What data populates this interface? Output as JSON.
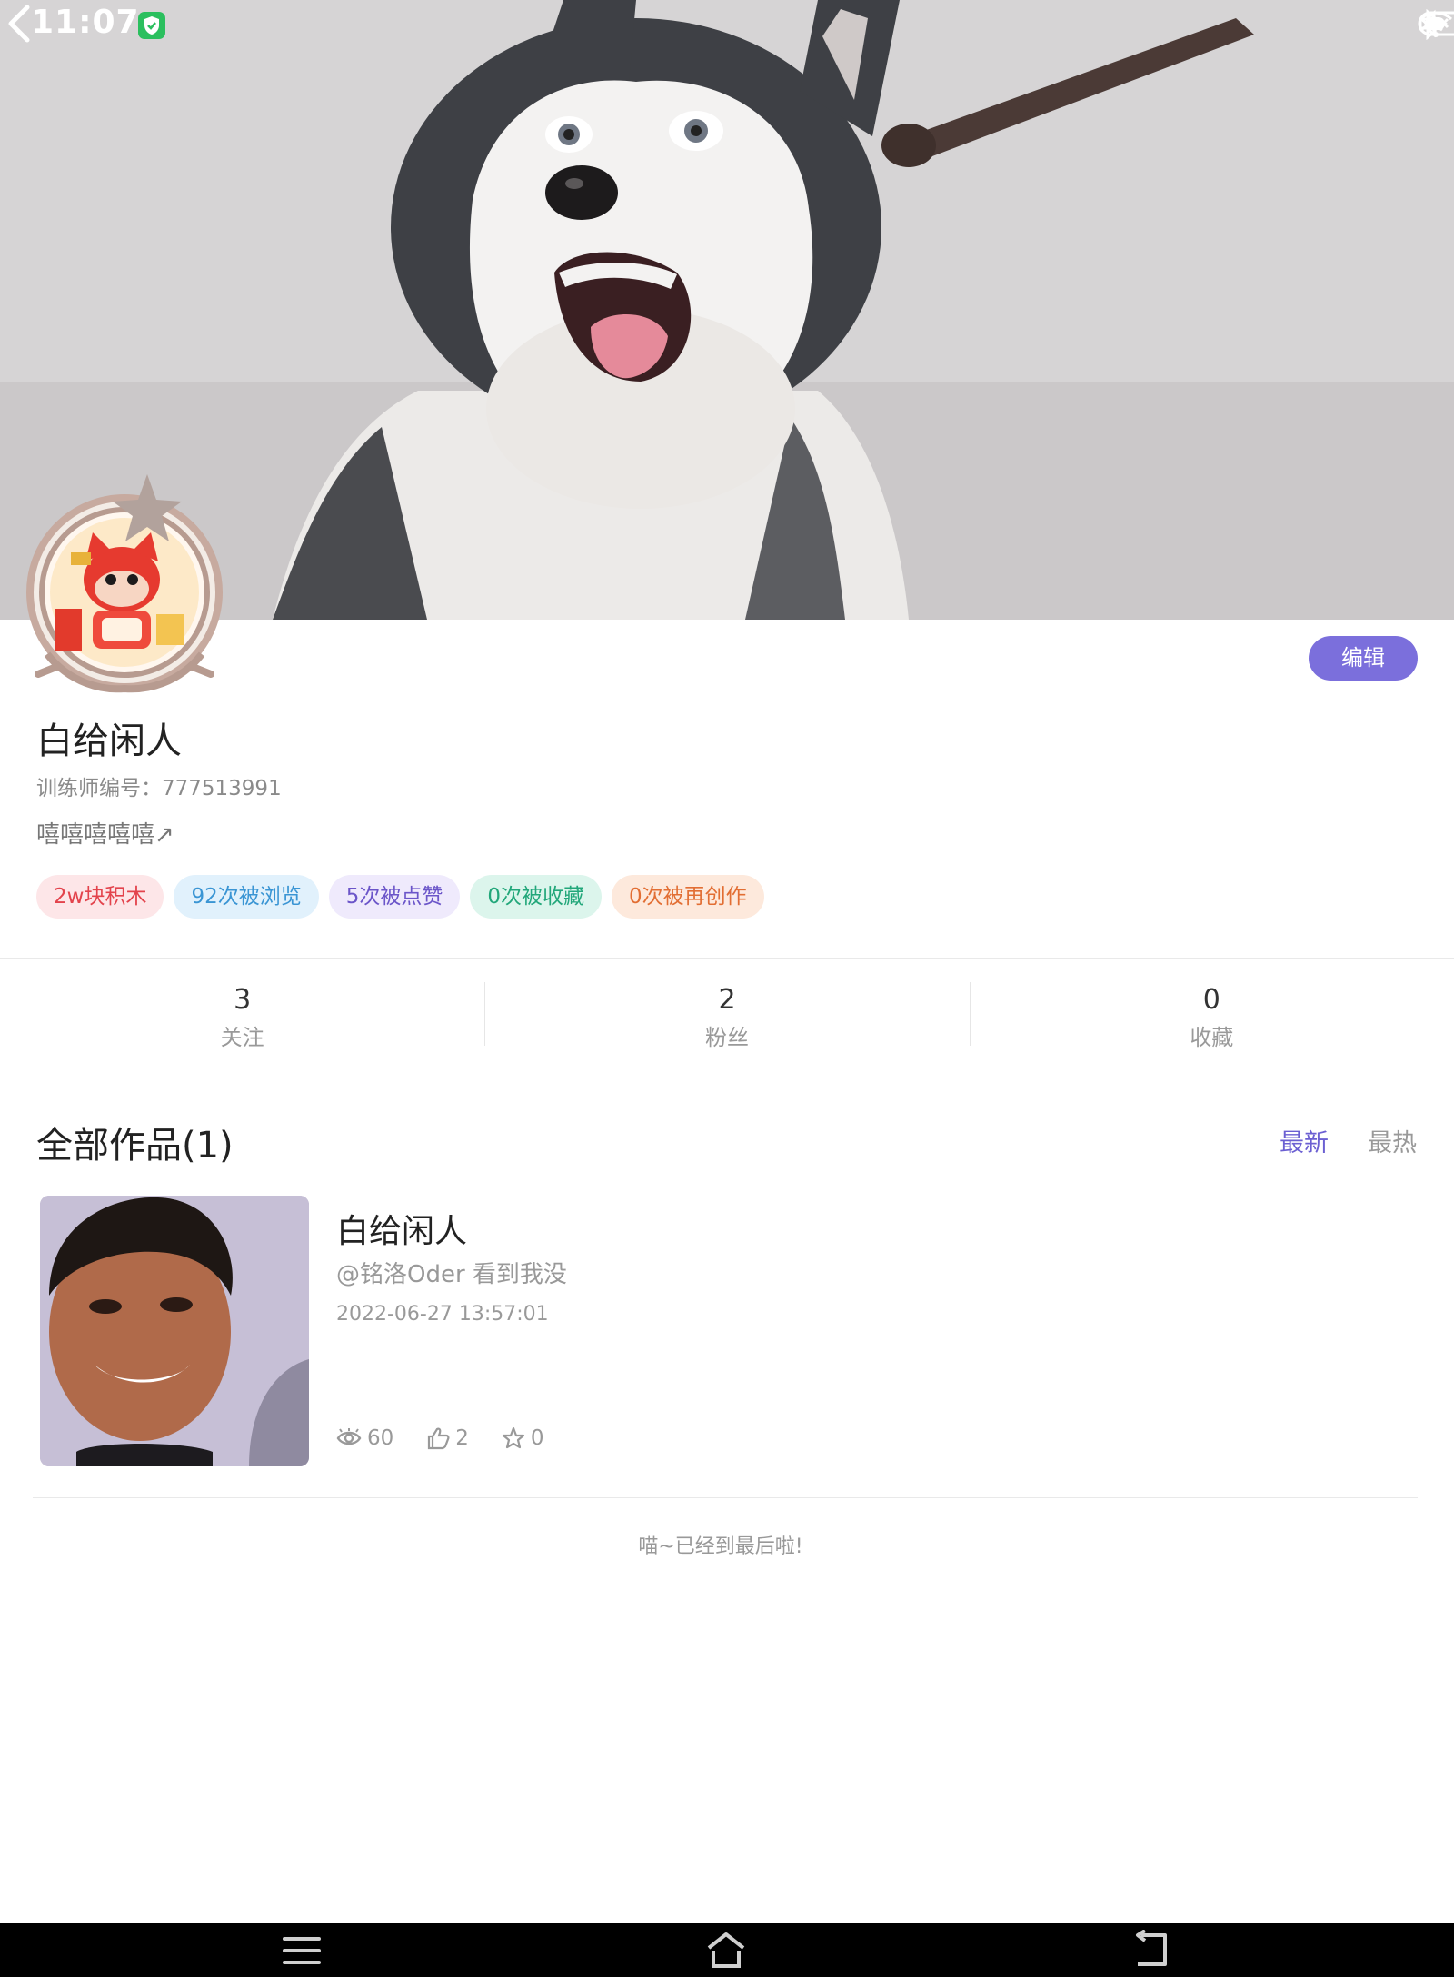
{
  "status_bar": {
    "time": "11:07"
  },
  "profile": {
    "edit_label": "编辑",
    "nickname": "白给闲人",
    "trainer_id_line": "训练师编号：777513991",
    "bio": "嘻嘻嘻嘻嘻↗",
    "tags": [
      "2w块积木",
      "92次被浏览",
      "5次被点赞",
      "0次被收藏",
      "0次被再创作"
    ]
  },
  "stats": [
    {
      "value": "3",
      "label": "关注"
    },
    {
      "value": "2",
      "label": "粉丝"
    },
    {
      "value": "0",
      "label": "收藏"
    }
  ],
  "works": {
    "title": "全部作品(1)",
    "sort_latest": "最新",
    "sort_hot": "最热",
    "items": [
      {
        "title": "白给闲人",
        "description": "@铭洛Oder 看到我没",
        "date": "2022-06-27 13:57:01",
        "views": "60",
        "likes": "2",
        "favorites": "0"
      }
    ],
    "end_note": "喵~已经到最后啦!"
  },
  "colors": {
    "accent": "#7b6fdc",
    "nav_bar": "#000000"
  },
  "icons": {
    "back": "chevron-left-icon",
    "views": "eye-icon",
    "likes": "thumbs-up-icon",
    "favorites": "star-icon",
    "nav_menu": "menu-icon",
    "nav_home": "home-icon",
    "nav_back": "return-icon"
  }
}
